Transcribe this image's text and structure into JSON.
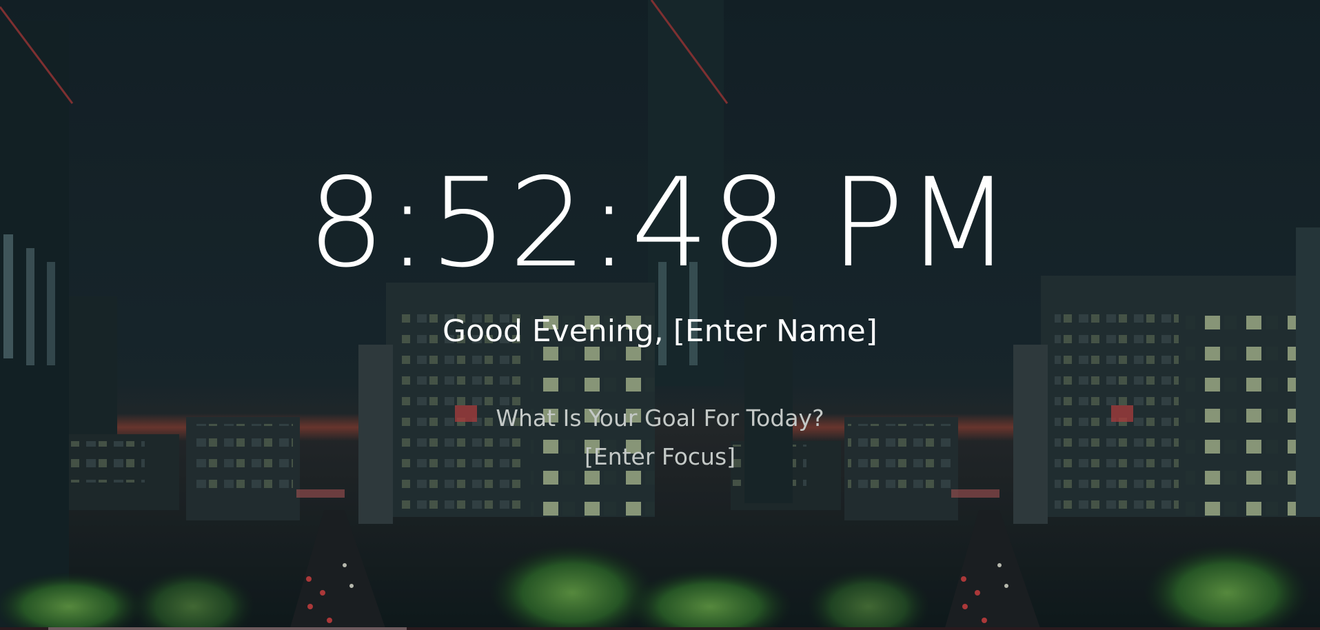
{
  "clock": {
    "time": "8:52:48 PM"
  },
  "greeting": {
    "prefix": "Good Evening, ",
    "name_placeholder": "[Enter Name]"
  },
  "focus": {
    "question": "What Is Your Goal For Today?",
    "placeholder": "[Enter Focus]"
  },
  "background": {
    "scene": "night-city-street-mirrored",
    "sky_color": "#15232a",
    "accent_glow": "#e0533a"
  }
}
